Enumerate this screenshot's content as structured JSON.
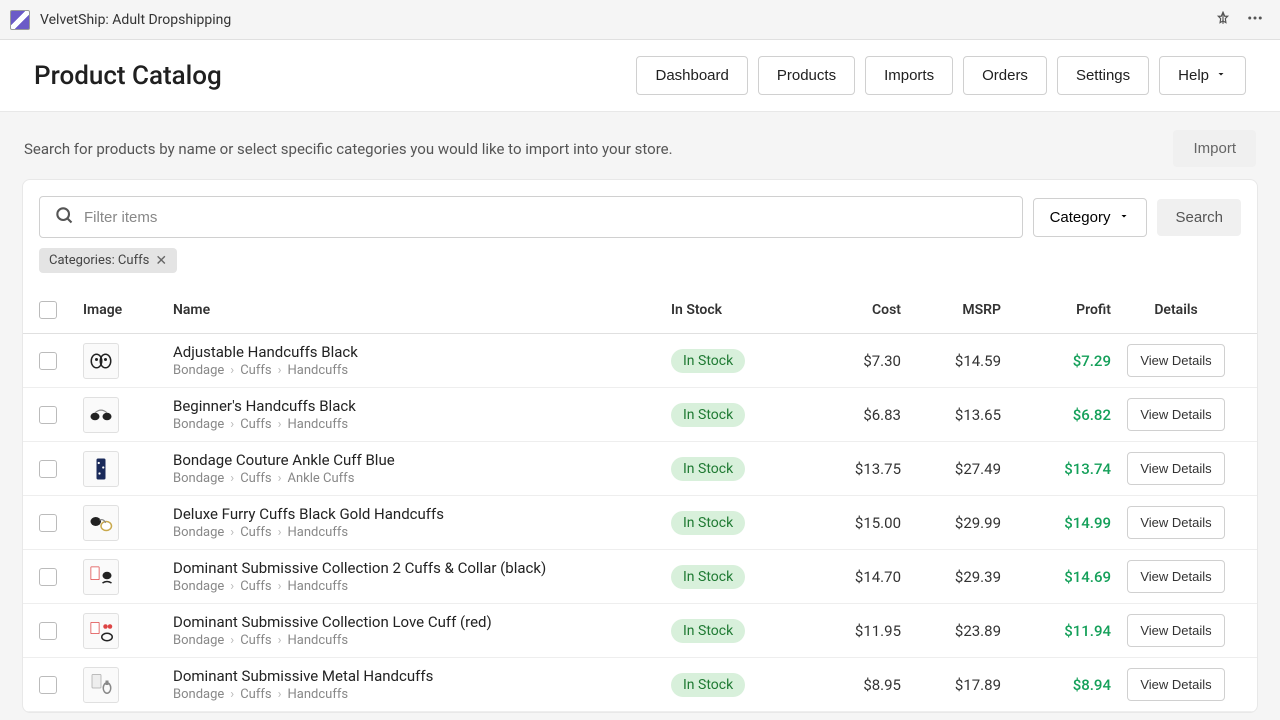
{
  "app": {
    "title": "VelvetShip: Adult Dropshipping"
  },
  "header": {
    "title": "Product Catalog",
    "nav": {
      "dashboard": "Dashboard",
      "products": "Products",
      "imports": "Imports",
      "orders": "Orders",
      "settings": "Settings",
      "help": "Help"
    }
  },
  "subheader": {
    "text": "Search for products by name or select specific categories you would like to import into your store.",
    "import": "Import"
  },
  "search": {
    "placeholder": "Filter items",
    "category_btn": "Category",
    "search_btn": "Search",
    "chip": "Categories: Cuffs"
  },
  "table": {
    "headers": {
      "image": "Image",
      "name": "Name",
      "stock": "In Stock",
      "cost": "Cost",
      "msrp": "MSRP",
      "profit": "Profit",
      "details": "Details"
    },
    "view_label": "View Details",
    "stock_label": "In Stock",
    "rows": [
      {
        "name": "Adjustable Handcuffs Black",
        "crumbs": [
          "Bondage",
          "Cuffs",
          "Handcuffs"
        ],
        "cost": "$7.30",
        "msrp": "$14.59",
        "profit": "$7.29"
      },
      {
        "name": "Beginner's Handcuffs Black",
        "crumbs": [
          "Bondage",
          "Cuffs",
          "Handcuffs"
        ],
        "cost": "$6.83",
        "msrp": "$13.65",
        "profit": "$6.82"
      },
      {
        "name": "Bondage Couture Ankle Cuff Blue",
        "crumbs": [
          "Bondage",
          "Cuffs",
          "Ankle Cuffs"
        ],
        "cost": "$13.75",
        "msrp": "$27.49",
        "profit": "$13.74"
      },
      {
        "name": "Deluxe Furry Cuffs Black Gold Handcuffs",
        "crumbs": [
          "Bondage",
          "Cuffs",
          "Handcuffs"
        ],
        "cost": "$15.00",
        "msrp": "$29.99",
        "profit": "$14.99"
      },
      {
        "name": "Dominant Submissive Collection 2 Cuffs & Collar (black)",
        "crumbs": [
          "Bondage",
          "Cuffs",
          "Handcuffs"
        ],
        "cost": "$14.70",
        "msrp": "$29.39",
        "profit": "$14.69"
      },
      {
        "name": "Dominant Submissive Collection Love Cuff (red)",
        "crumbs": [
          "Bondage",
          "Cuffs",
          "Handcuffs"
        ],
        "cost": "$11.95",
        "msrp": "$23.89",
        "profit": "$11.94"
      },
      {
        "name": "Dominant Submissive Metal Handcuffs",
        "crumbs": [
          "Bondage",
          "Cuffs",
          "Handcuffs"
        ],
        "cost": "$8.95",
        "msrp": "$17.89",
        "profit": "$8.94"
      }
    ]
  }
}
